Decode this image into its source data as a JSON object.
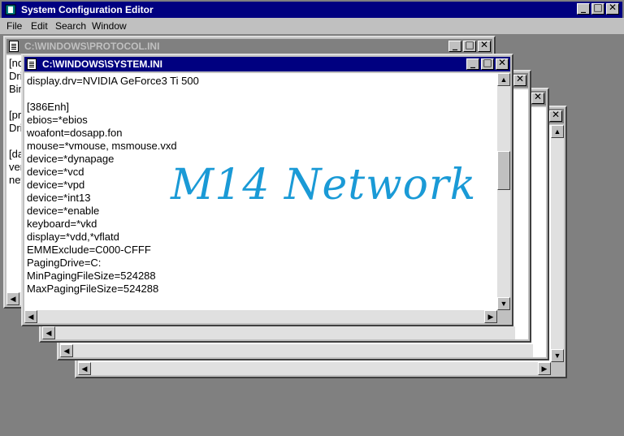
{
  "app": {
    "title": "System Configuration Editor"
  },
  "menu": [
    "File",
    "Edit",
    "Search",
    "Window"
  ],
  "win_protocol": {
    "title": "C:\\WINDOWS\\PROTOCOL.INI",
    "lines": [
      "[nd",
      "Dri",
      "Bin",
      "",
      "[pr",
      "Dri",
      "",
      "[da",
      "ver",
      "net"
    ]
  },
  "win_system": {
    "title": "C:\\WINDOWS\\SYSTEM.INI",
    "lines": [
      "display.drv=NVIDIA GeForce3 Ti 500",
      "",
      "[386Enh]",
      "ebios=*ebios",
      "woafont=dosapp.fon",
      "mouse=*vmouse, msmouse.vxd",
      "device=*dynapage",
      "device=*vcd",
      "device=*vpd",
      "device=*int13",
      "device=*enable",
      "keyboard=*vkd",
      "display=*vdd,*vflatd",
      "EMMExclude=C000-CFFF",
      "PagingDrive=C:",
      "MinPagingFileSize=524288",
      "MaxPagingFileSize=524288"
    ]
  },
  "watermark": "M14 Network",
  "buttons": {
    "minimize": "_",
    "maximize": "□",
    "close": "✕"
  },
  "colors": {
    "active_caption": "#000080",
    "inactive_caption": "#808080",
    "watermark": "#1a9ad6"
  }
}
